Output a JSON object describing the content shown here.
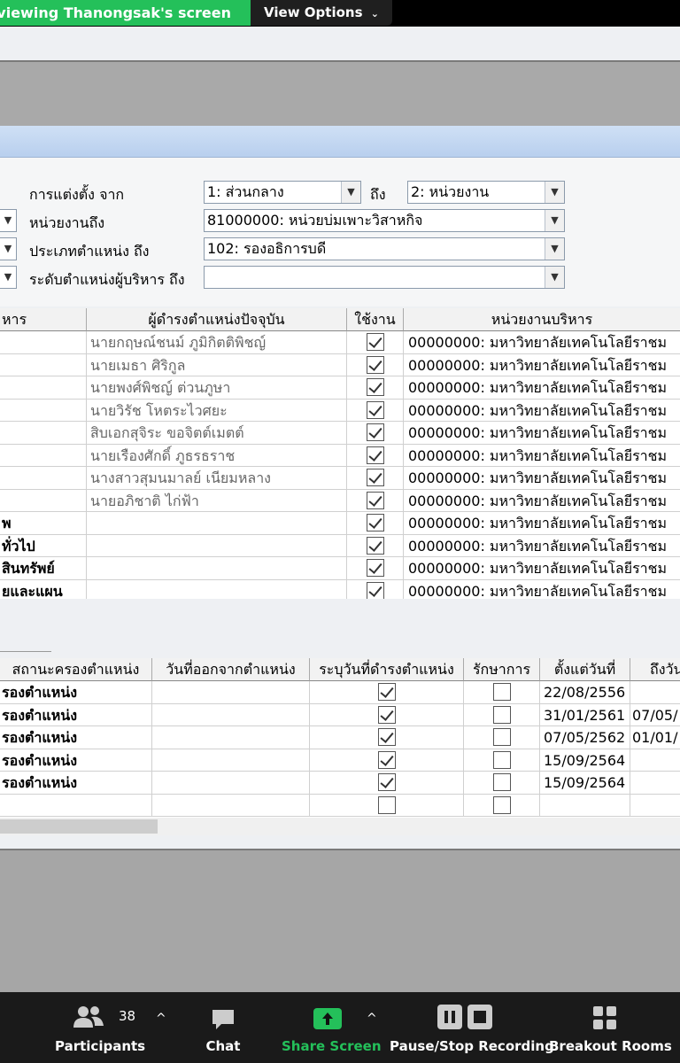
{
  "zoom": {
    "banner": "ou are viewing Thanongsak's screen",
    "view_options": "View Options",
    "participants_count": "38",
    "toolbar": {
      "participants": "Participants",
      "chat": "Chat",
      "share_screen": "Share Screen",
      "pause_stop": "Pause/Stop Recording",
      "breakout": "Breakout Rooms"
    },
    "colors": {
      "share_green": "#24c05a",
      "toolbar_bg": "#1a1a1a"
    }
  },
  "form": {
    "appoint_from_label": "การแต่งตั้ง จาก",
    "appoint_from_value": "1: ส่วนกลาง",
    "to_label": "ถึง",
    "appoint_to_value": "2: หน่วยงาน",
    "unit_label": "หน่วยงานถึง",
    "unit_value": "81000000: หน่วยบ่มเพาะวิสาหกิจ",
    "position_type_label": "ประเภทตำแหน่ง ถึง",
    "position_type_value": "102: รองอธิการบดี",
    "exec_level_label": "ระดับตำแหน่งผู้บริหาร ถึง",
    "exec_level_value": ""
  },
  "grid1": {
    "headers": [
      "หาร",
      "ผู้ดำรงตำแหน่งปัจจุบัน",
      "ใช้งาน",
      "หน่วยงานบริหาร"
    ],
    "rows": [
      {
        "c0": "",
        "holder": "นายกฤษณ์ชนม์ ภูมิกิตติพิชญ์",
        "unit": "00000000: มหาวิทยาลัยเทคโนโลยีราชม"
      },
      {
        "c0": "",
        "holder": "นายเมธา ศิริกูล",
        "unit": "00000000: มหาวิทยาลัยเทคโนโลยีราชม"
      },
      {
        "c0": "",
        "holder": "นายพงศ์พิชญ์ ต่วนภูษา",
        "unit": "00000000: มหาวิทยาลัยเทคโนโลยีราชม"
      },
      {
        "c0": "",
        "holder": "นายวิรัช โหตระไวศยะ",
        "unit": "00000000: มหาวิทยาลัยเทคโนโลยีราชม"
      },
      {
        "c0": "",
        "holder": "สิบเอกสุจิระ ขอจิตต์เมตต์",
        "unit": "00000000: มหาวิทยาลัยเทคโนโลยีราชม"
      },
      {
        "c0": "",
        "holder": "นายเรืองศักดิ์ ภูธรธราช",
        "unit": "00000000: มหาวิทยาลัยเทคโนโลยีราชม"
      },
      {
        "c0": "",
        "holder": "นางสาวสุมนมาลย์ เนียมหลาง",
        "unit": "00000000: มหาวิทยาลัยเทคโนโลยีราชม"
      },
      {
        "c0": "",
        "holder": "นายอภิชาติ ไก่ฟ้า",
        "unit": "00000000: มหาวิทยาลัยเทคโนโลยีราชม"
      },
      {
        "c0": "พ",
        "holder": "",
        "unit": "00000000: มหาวิทยาลัยเทคโนโลยีราชม"
      },
      {
        "c0": "ทั่วไป",
        "holder": "",
        "unit": "00000000: มหาวิทยาลัยเทคโนโลยีราชม"
      },
      {
        "c0": "สินทรัพย์",
        "holder": "",
        "unit": "00000000: มหาวิทยาลัยเทคโนโลยีราชม"
      },
      {
        "c0": "ยและแผน",
        "holder": "",
        "unit": "00000000: มหาวิทยาลัยเทคโนโลยีราชม"
      }
    ]
  },
  "grid2": {
    "headers": [
      "สถานะครองตำแหน่ง",
      "วันที่ออกจากตำแหน่ง",
      "ระบุวันที่ดำรงตำแหน่ง",
      "รักษาการ",
      "ตั้งแต่วันที่",
      "ถึงวัน"
    ],
    "rows": [
      {
        "status": "รองตำแหน่ง",
        "specify": true,
        "acting": false,
        "from": "22/08/2556",
        "to": ""
      },
      {
        "status": "รองตำแหน่ง",
        "specify": true,
        "acting": false,
        "from": "31/01/2561",
        "to": "07/05/"
      },
      {
        "status": "รองตำแหน่ง",
        "specify": true,
        "acting": false,
        "from": "07/05/2562",
        "to": "01/01/"
      },
      {
        "status": "รองตำแหน่ง",
        "specify": true,
        "acting": false,
        "from": "15/09/2564",
        "to": ""
      },
      {
        "status": "รองตำแหน่ง",
        "specify": true,
        "acting": false,
        "from": "15/09/2564",
        "to": ""
      },
      {
        "status": "",
        "specify": false,
        "acting": false,
        "from": "",
        "to": ""
      }
    ]
  }
}
